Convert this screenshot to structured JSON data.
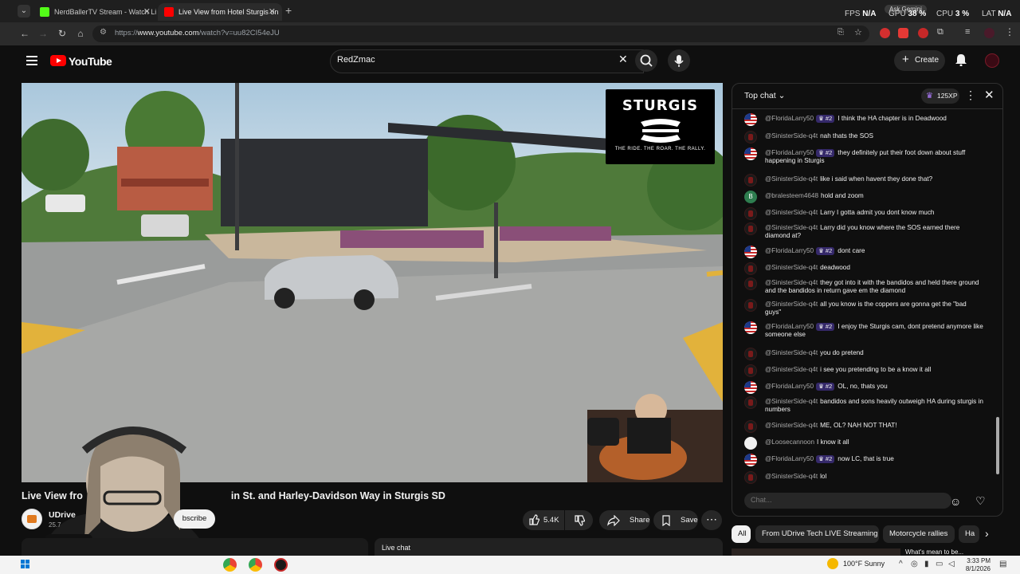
{
  "browser": {
    "tabs": [
      {
        "title": "NerdBallerTV Stream - Watch Li",
        "favicon_color": "#53fc18",
        "active": false
      },
      {
        "title": "Live View from Hotel Sturgis on",
        "favicon_color": "#ff0000",
        "active": true
      }
    ],
    "new_tab": "+",
    "overlay": {
      "fps_label": "FPS",
      "fps_value": "N/A",
      "gpu_label": "GPU",
      "gpu_value": "38 %",
      "cpu_label": "CPU",
      "cpu_value": "3 %",
      "lat_label": "LAT",
      "lat_value": "N/A",
      "ask_gemini": "Ask Gemini"
    },
    "url_prefix": "https://",
    "url_host": "www.youtube.com",
    "url_path": "/watch?v=uu82CI54eJU"
  },
  "youtube": {
    "logo_text": "YouTube",
    "search_value": "RedZmac",
    "create_label": "Create",
    "accent": "#ff0000"
  },
  "video": {
    "overlay_brand": "STURGIS",
    "overlay_tagline": "THE RIDE. THE ROAR. THE RALLY.",
    "title": "Live View fro",
    "title_rest": "in St. and Harley-Davidson Way in Sturgis SD",
    "channel_name": "UDrive",
    "subscriber_count": "25.7",
    "subscribe_label": "bscribe",
    "like_count": "5.4K",
    "share_label": "Share",
    "save_label": "Save",
    "more_label": "⋯",
    "below_panel_label": "Live chat"
  },
  "chat": {
    "mode_label": "Top chat",
    "xp_label": "125XP",
    "input_placeholder": "Chat...",
    "messages": [
      {
        "author": "@FloridaLarry50",
        "badge": "♛ #2",
        "text": "I think the HA chapter is in Deadwood",
        "avatar": "us"
      },
      {
        "author": "@SinisterSide-q4t",
        "badge": "",
        "text": "nah thats the SOS",
        "avatar": "dark"
      },
      {
        "author": "@FloridaLarry50",
        "badge": "♛ #2",
        "text": "they definitely put their foot down about stuff happening in Sturgis",
        "avatar": "us"
      },
      {
        "author": "@SinisterSide-q4t",
        "badge": "",
        "text": "like i said when havent they done that?",
        "avatar": "dark"
      },
      {
        "author": "@bralesteem4648",
        "badge": "",
        "text": "hold and zoom",
        "avatar": "b"
      },
      {
        "author": "@SinisterSide-q4t",
        "badge": "",
        "text": "Larry I gotta admit you dont know much",
        "avatar": "dark"
      },
      {
        "author": "@SinisterSide-q4t",
        "badge": "",
        "text": "Larry did you know where the SOS earned there diamond at?",
        "avatar": "dark"
      },
      {
        "author": "@FloridaLarry50",
        "badge": "♛ #2",
        "text": "dont care",
        "avatar": "us"
      },
      {
        "author": "@SinisterSide-q4t",
        "badge": "",
        "text": "deadwood",
        "avatar": "dark"
      },
      {
        "author": "@SinisterSide-q4t",
        "badge": "",
        "text": "they got into it with the bandidos and held there ground and the bandidos in return gave em the diamond",
        "avatar": "dark"
      },
      {
        "author": "@SinisterSide-q4t",
        "badge": "",
        "text": "all you know is the coppers are gonna get the \"bad guys\"",
        "avatar": "dark"
      },
      {
        "author": "@FloridaLarry50",
        "badge": "♛ #2",
        "text": "I enjoy the Sturgis cam, dont pretend anymore like someone else",
        "avatar": "us"
      },
      {
        "author": "@SinisterSide-q4t",
        "badge": "",
        "text": "you do pretend",
        "avatar": "dark"
      },
      {
        "author": "@SinisterSide-q4t",
        "badge": "",
        "text": "i see you pretending to be a know it all",
        "avatar": "dark"
      },
      {
        "author": "@FloridaLarry50",
        "badge": "♛ #2",
        "text": "OL, no, thats you",
        "avatar": "us"
      },
      {
        "author": "@SinisterSide-q4t",
        "badge": "",
        "text": "bandidos and sons heavily outweigh HA during sturgis in numbers",
        "avatar": "dark"
      },
      {
        "author": "@SinisterSide-q4t",
        "badge": "",
        "text": "ME, OL? NAH NOT THAT!",
        "avatar": "dark"
      },
      {
        "author": "@Loosecannoon",
        "badge": "",
        "text": "I know it all",
        "avatar": "w"
      },
      {
        "author": "@FloridaLarry50",
        "badge": "♛ #2",
        "text": "now LC, that is true",
        "avatar": "us"
      },
      {
        "author": "@SinisterSide-q4t",
        "badge": "",
        "text": "lol",
        "avatar": "dark"
      }
    ]
  },
  "chips": [
    {
      "label": "All"
    },
    {
      "label": "From UDrive Tech LIVE Streaming"
    },
    {
      "label": "Motorcycle rallies"
    },
    {
      "label": "Ha"
    }
  ],
  "next_hint": "What's mean to be...",
  "taskbar": {
    "weather": "100°F  Sunny",
    "time": "3:33 PM",
    "date": "8/1/2026"
  }
}
